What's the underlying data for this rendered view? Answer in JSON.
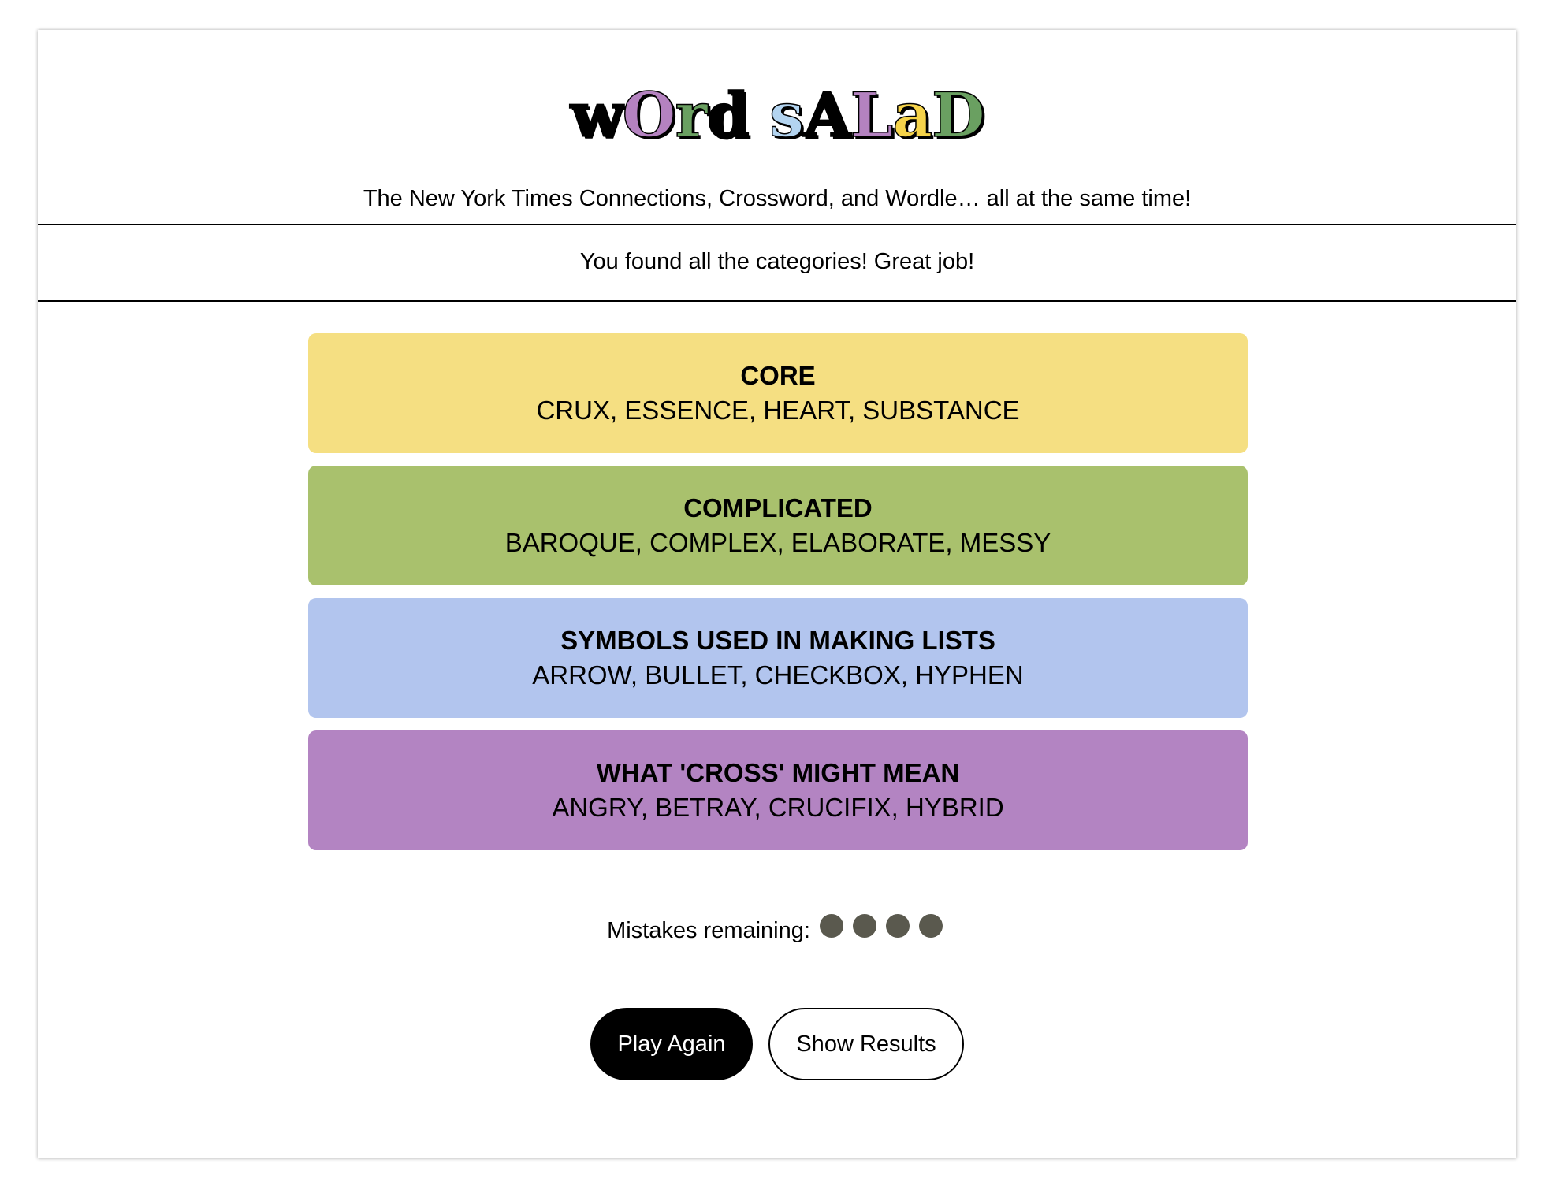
{
  "logo": {
    "letters": [
      {
        "char": "w",
        "color": "#000000"
      },
      {
        "char": "O",
        "color": "#b482c0"
      },
      {
        "char": "r",
        "color": "#6aa061"
      },
      {
        "char": "d",
        "color": "#000000"
      },
      {
        "char": " ",
        "color": "#000000"
      },
      {
        "char": "s",
        "color": "#b3d4f0"
      },
      {
        "char": "A",
        "color": "#000000"
      },
      {
        "char": "L",
        "color": "#b482c0"
      },
      {
        "char": "a",
        "color": "#f5d34a"
      },
      {
        "char": "D",
        "color": "#6aa061"
      }
    ]
  },
  "tagline": "The New York Times Connections, Crossword, and Wordle… all at the same time!",
  "status_message": "You found all the categories! Great job!",
  "groups": [
    {
      "title": "CORE",
      "words": "CRUX, ESSENCE, HEART, SUBSTANCE",
      "color": "#f5df82"
    },
    {
      "title": "COMPLICATED",
      "words": "BAROQUE, COMPLEX, ELABORATE, MESSY",
      "color": "#a9c16d"
    },
    {
      "title": "SYMBOLS USED IN MAKING LISTS",
      "words": "ARROW, BULLET, CHECKBOX, HYPHEN",
      "color": "#b2c5ee"
    },
    {
      "title": "WHAT 'CROSS' MIGHT MEAN",
      "words": "ANGRY, BETRAY, CRUCIFIX, HYBRID",
      "color": "#b384c2"
    }
  ],
  "mistakes": {
    "label": "Mistakes remaining:",
    "remaining": 4,
    "dot_color": "#5a594e"
  },
  "buttons": {
    "play_again": "Play Again",
    "show_results": "Show Results"
  }
}
